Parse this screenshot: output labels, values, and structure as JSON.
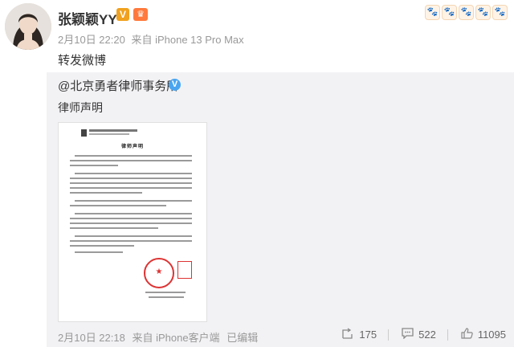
{
  "post": {
    "username": "张颖颖YY",
    "date": "2月10日 22:20",
    "source": "来自 iPhone 13 Pro Max",
    "text": "转发微博"
  },
  "badges": {
    "v_badge": "V",
    "crown_badge": "♛"
  },
  "repost": {
    "original_user": "@北京勇者律师事务所",
    "verified": "V",
    "text": "律师声明",
    "footer": {
      "date": "2月10日 22:18",
      "source": "来自 iPhone客户端",
      "edited": "已编辑"
    },
    "actions": {
      "forward_count": "175",
      "comment_count": "522",
      "like_count": "11095"
    }
  },
  "document": {
    "title": "律师声明"
  },
  "icons": [
    "paw-icon",
    "forward-icon",
    "comment-icon",
    "like-icon"
  ],
  "colors": {
    "repost_bg": "#f2f2f5",
    "meta_text": "#999999",
    "verified_blue": "#4aa5f0",
    "seal_red": "#dd3333"
  }
}
